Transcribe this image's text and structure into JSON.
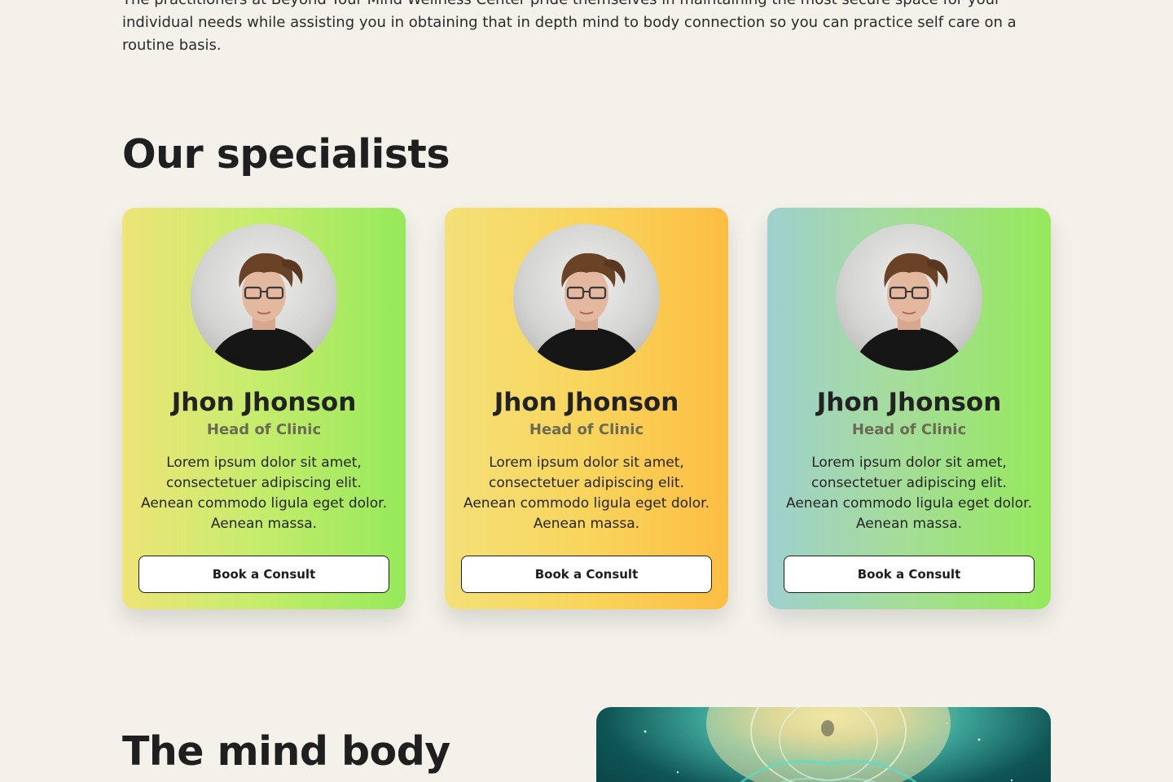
{
  "intro": {
    "text": "The practitioners at Beyond Your Mind Wellness Center pride themselves in maintaining the most secure space for your individual needs while assisting you in obtaining that in depth mind to body connection so you can practice self care on a routine basis."
  },
  "specialists": {
    "heading": "Our specialists",
    "cards": [
      {
        "name": "Jhon Jhonson",
        "role": "Head of Clinic",
        "description": "Lorem ipsum dolor sit amet, consectetuer adipiscing elit. Aenean commodo ligula eget dolor. Aenean massa.",
        "button_label": "Book a Consult",
        "colors": [
          "#eee477",
          "#96e95a"
        ]
      },
      {
        "name": "Jhon Jhonson",
        "role": "Head of Clinic",
        "description": "Lorem ipsum dolor sit amet, consectetuer adipiscing elit. Aenean commodo ligula eget dolor. Aenean massa.",
        "button_label": "Book a Consult",
        "colors": [
          "#f4e079",
          "#fdbd43"
        ]
      },
      {
        "name": "Jhon Jhonson",
        "role": "Head of Clinic",
        "description": "Lorem ipsum dolor sit amet, consectetuer adipiscing elit. Aenean commodo ligula eget dolor. Aenean massa.",
        "button_label": "Book a Consult",
        "colors": [
          "#9fd0cf",
          "#95e95a"
        ]
      }
    ]
  },
  "mind_body": {
    "heading": "The mind body"
  },
  "colors": {
    "background": "#f4f1eb",
    "text": "#1e1e1e",
    "role_text": "#6b6b55",
    "button_bg": "#ffffff"
  }
}
